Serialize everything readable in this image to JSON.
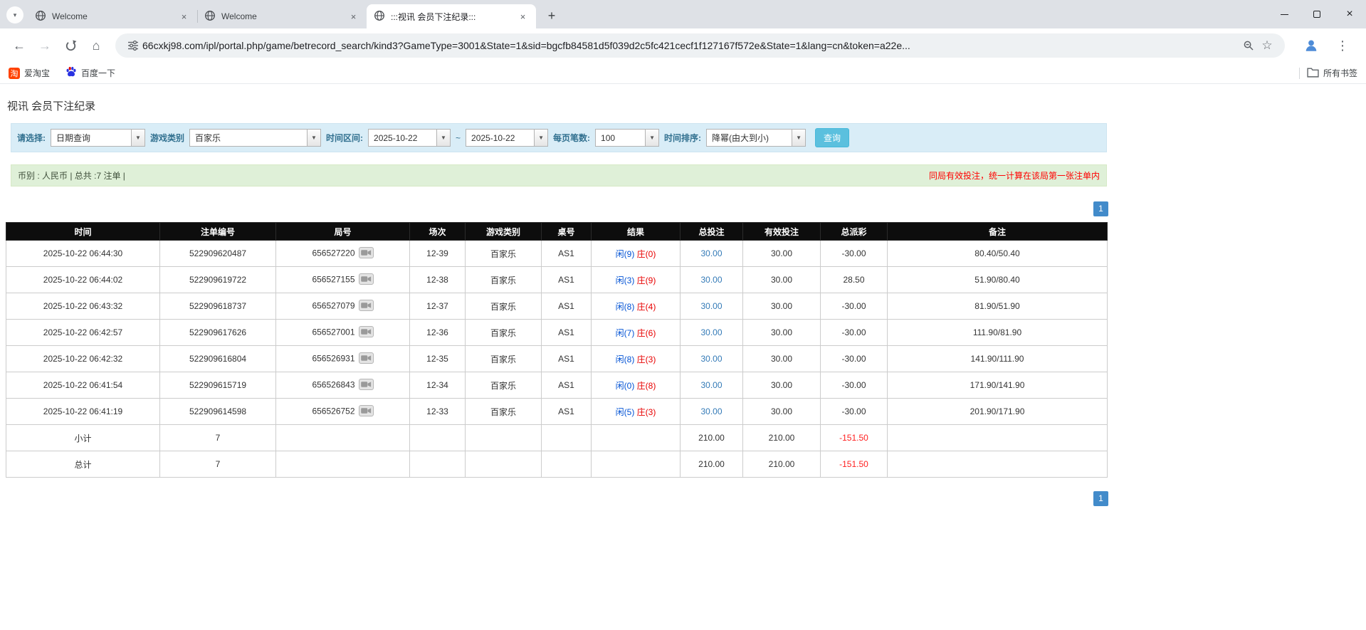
{
  "browser": {
    "tabs": [
      {
        "label": "Welcome",
        "active": false
      },
      {
        "label": "Welcome",
        "active": false
      },
      {
        "label": ":::视讯 会员下注纪录:::",
        "active": true
      }
    ],
    "url": "66cxkj98.com/ipl/portal.php/game/betrecord_search/kind3?GameType=3001&State=1&sid=bgcfb84581d5f039d2c5fc421cecf1f127167f572e&State=1&lang=cn&token=a22e...",
    "bookmarks": {
      "aitaobao": {
        "glyph": "淘",
        "label": "爱淘宝"
      },
      "baidu": {
        "label": "百度一下"
      },
      "all": {
        "label": "所有书签"
      }
    }
  },
  "page": {
    "title": "视讯 会员下注纪录",
    "filter": {
      "select_label": "请选择:",
      "select_value": "日期查询",
      "game_label": "游戏类别",
      "game_value": "百家乐",
      "range_label": "时间区间:",
      "date_from": "2025-10-22",
      "tilde": "~",
      "date_to": "2025-10-22",
      "per_page_label": "每页笔数:",
      "per_page_value": "100",
      "sort_label": "时间排序:",
      "sort_value": "降幂(由大到小)",
      "search_button": "查询"
    },
    "info_bar": {
      "left": "币别 : 人民币 | 总共 :7 注单 |",
      "right": "同局有效投注，统一计算在该局第一张注单内"
    },
    "pagination": {
      "page": "1"
    },
    "table": {
      "headers": [
        "时间",
        "注单编号",
        "局号",
        "场次",
        "游戏类别",
        "桌号",
        "结果",
        "总投注",
        "有效投注",
        "总派彩",
        "备注"
      ],
      "rows": [
        {
          "time": "2025-10-22 06:44:30",
          "bet_no": "522909620487",
          "round_no": "656527220",
          "session": "12-39",
          "game": "百家乐",
          "table_no": "AS1",
          "result_player": "闲(9)",
          "result_banker": "庄(0)",
          "total_bet": "30.00",
          "valid_bet": "30.00",
          "payout": "-30.00",
          "remark": "80.40/50.40"
        },
        {
          "time": "2025-10-22 06:44:02",
          "bet_no": "522909619722",
          "round_no": "656527155",
          "session": "12-38",
          "game": "百家乐",
          "table_no": "AS1",
          "result_player": "闲(3)",
          "result_banker": "庄(9)",
          "total_bet": "30.00",
          "valid_bet": "30.00",
          "payout": "28.50",
          "remark": "51.90/80.40"
        },
        {
          "time": "2025-10-22 06:43:32",
          "bet_no": "522909618737",
          "round_no": "656527079",
          "session": "12-37",
          "game": "百家乐",
          "table_no": "AS1",
          "result_player": "闲(8)",
          "result_banker": "庄(4)",
          "total_bet": "30.00",
          "valid_bet": "30.00",
          "payout": "-30.00",
          "remark": "81.90/51.90"
        },
        {
          "time": "2025-10-22 06:42:57",
          "bet_no": "522909617626",
          "round_no": "656527001",
          "session": "12-36",
          "game": "百家乐",
          "table_no": "AS1",
          "result_player": "闲(7)",
          "result_banker": "庄(6)",
          "total_bet": "30.00",
          "valid_bet": "30.00",
          "payout": "-30.00",
          "remark": "111.90/81.90"
        },
        {
          "time": "2025-10-22 06:42:32",
          "bet_no": "522909616804",
          "round_no": "656526931",
          "session": "12-35",
          "game": "百家乐",
          "table_no": "AS1",
          "result_player": "闲(8)",
          "result_banker": "庄(3)",
          "total_bet": "30.00",
          "valid_bet": "30.00",
          "payout": "-30.00",
          "remark": "141.90/111.90"
        },
        {
          "time": "2025-10-22 06:41:54",
          "bet_no": "522909615719",
          "round_no": "656526843",
          "session": "12-34",
          "game": "百家乐",
          "table_no": "AS1",
          "result_player": "闲(0)",
          "result_banker": "庄(8)",
          "total_bet": "30.00",
          "valid_bet": "30.00",
          "payout": "-30.00",
          "remark": "171.90/141.90"
        },
        {
          "time": "2025-10-22 06:41:19",
          "bet_no": "522909614598",
          "round_no": "656526752",
          "session": "12-33",
          "game": "百家乐",
          "table_no": "AS1",
          "result_player": "闲(5)",
          "result_banker": "庄(3)",
          "total_bet": "30.00",
          "valid_bet": "30.00",
          "payout": "-30.00",
          "remark": "201.90/171.90"
        }
      ],
      "subtotal": {
        "label": "小计",
        "count": "7",
        "total_bet": "210.00",
        "valid_bet": "210.00",
        "payout": "-151.50"
      },
      "total": {
        "label": "总计",
        "count": "7",
        "total_bet": "210.00",
        "valid_bet": "210.00",
        "payout": "-151.50"
      }
    }
  }
}
